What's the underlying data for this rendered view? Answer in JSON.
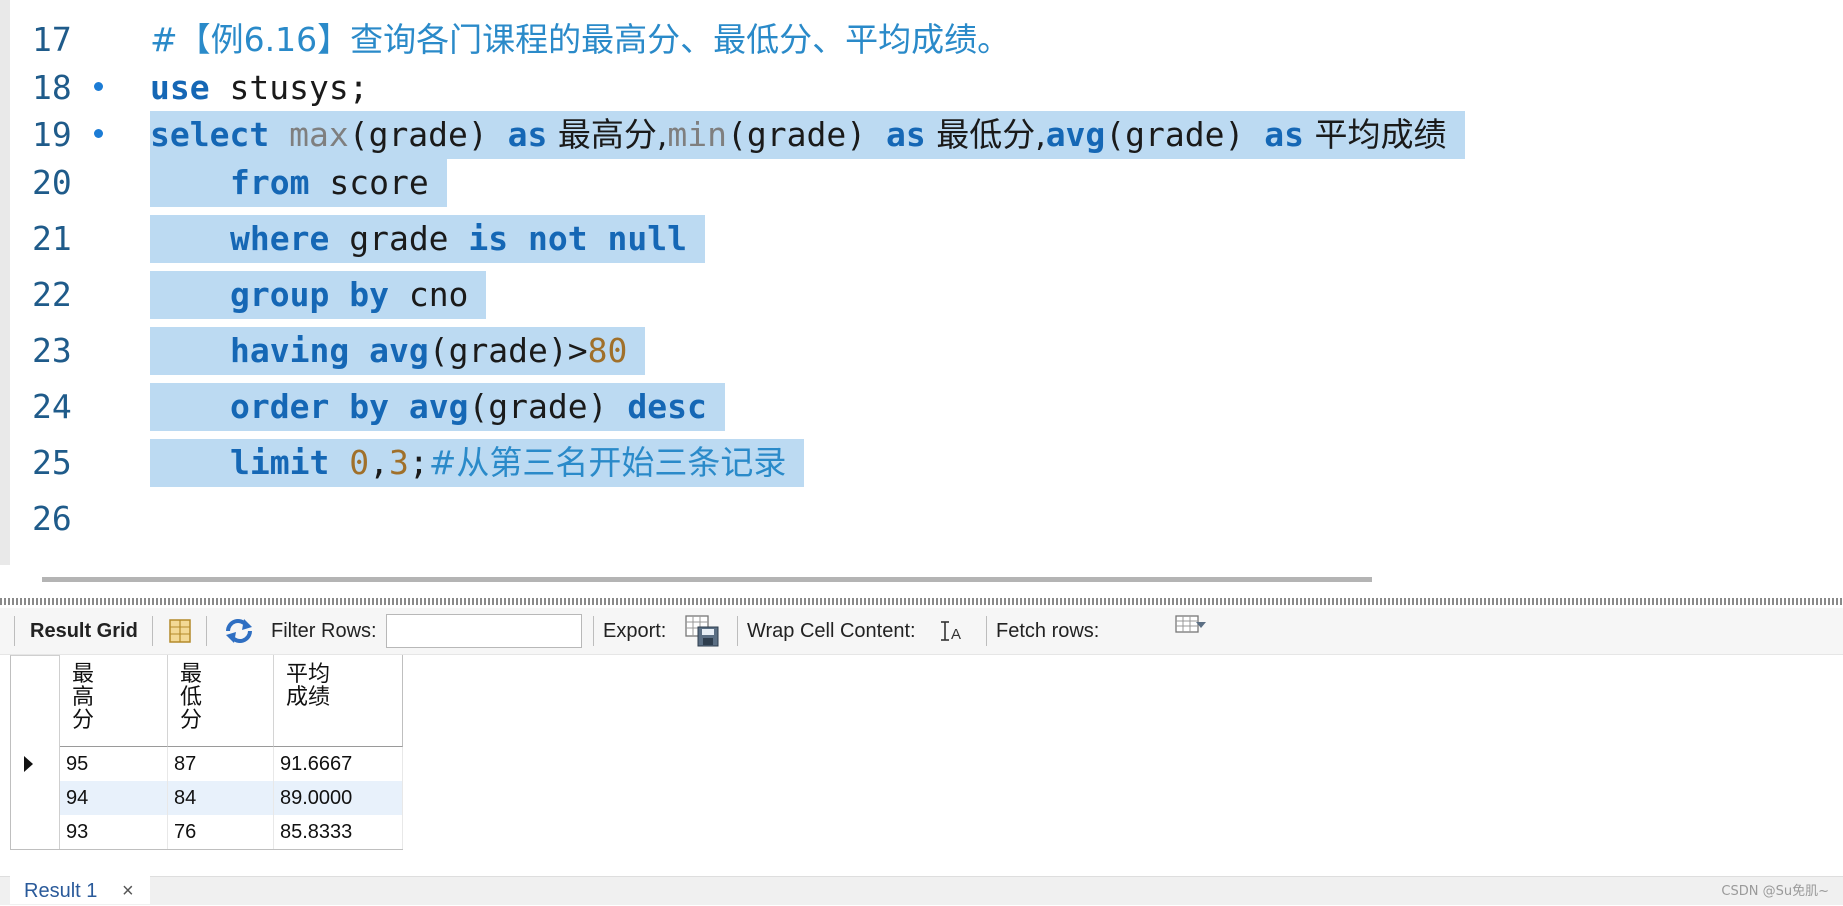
{
  "editor": {
    "lines": [
      {
        "num": "17"
      },
      {
        "num": "18"
      },
      {
        "num": "19"
      },
      {
        "num": "20"
      },
      {
        "num": "21"
      },
      {
        "num": "22"
      },
      {
        "num": "23"
      },
      {
        "num": "24"
      },
      {
        "num": "25"
      },
      {
        "num": "26"
      }
    ],
    "l17": {
      "comment": "#【例6.16】查询各门课程的最高分、最低分、平均成绩。"
    },
    "l18": {
      "kw_use": "use",
      "db": " stusys;"
    },
    "l19": {
      "kw_select": "select",
      "fn_max": "max",
      "t1": "(grade) ",
      "kw_as1": "as",
      "alias1": " 最高分,",
      "fn_min": "min",
      "t2": "(grade) ",
      "kw_as2": "as",
      "alias2": " 最低分,",
      "fn_avg": "avg",
      "t3": "(grade) ",
      "kw_as3": "as",
      "alias3": " 平均成绩"
    },
    "l20": {
      "kw_from": "from",
      "table": " score"
    },
    "l21": {
      "kw_where": "where",
      "col": " grade ",
      "kw_isnotnull": "is not null"
    },
    "l22": {
      "kw_groupby": "group by",
      "col": " cno"
    },
    "l23": {
      "kw_having": "having",
      "sp": " ",
      "fn_avg": "avg",
      "t": "(grade)>",
      "num": "80"
    },
    "l24": {
      "kw_orderby": "order by",
      "sp": " ",
      "fn_avg": "avg",
      "t": "(grade) ",
      "kw_desc": "desc"
    },
    "l25": {
      "kw_limit": "limit",
      "sp": " ",
      "n0": "0",
      "comma": ",",
      "n3": "3",
      "semi": ";",
      "comment": "#从第三名开始三条记录"
    }
  },
  "toolbar": {
    "result_grid": "Result Grid",
    "filter_rows": "Filter Rows:",
    "filter_value": "",
    "export": "Export:",
    "wrap": "Wrap Cell Content:",
    "fetch": "Fetch rows:"
  },
  "grid": {
    "columns": [
      "最高分",
      "最低分",
      "平均成绩"
    ],
    "rows": [
      [
        "95",
        "87",
        "91.6667"
      ],
      [
        "94",
        "84",
        "89.0000"
      ],
      [
        "93",
        "76",
        "85.8333"
      ]
    ]
  },
  "result_tab": {
    "label": "Result 1",
    "close": "×"
  },
  "watermark": "CSDN @Su免肌~",
  "colors": {
    "keyword": "#1567b5",
    "selection": "#bcdaf2",
    "comment": "#2a8ac9",
    "number": "#a0702a",
    "line_number": "#1f5b8a"
  }
}
